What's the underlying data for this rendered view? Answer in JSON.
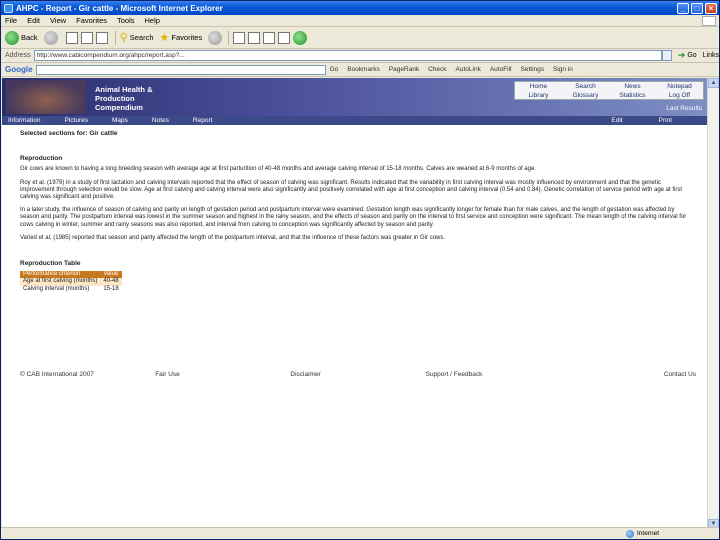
{
  "window": {
    "title": "AHPC - Report - Gir cattle - Microsoft Internet Explorer",
    "minimize": "_",
    "maximize": "□",
    "close": "×"
  },
  "menu": [
    "File",
    "Edit",
    "View",
    "Favorites",
    "Tools",
    "Help"
  ],
  "toolbar": {
    "back": "Back",
    "search": "Search",
    "favorites": "Favorites"
  },
  "address": {
    "label": "Address",
    "url": "http://www.cabicompendium.org/ahpc/report.asp?...",
    "go": "Go",
    "links": "Links"
  },
  "google": {
    "logo": "Google",
    "items": [
      "Go",
      "Bookmarks",
      "PageRank",
      "Check",
      "AutoLink",
      "AutoFill",
      "Settings",
      "Sign in"
    ]
  },
  "site": {
    "brand_lines": [
      "Animal Health &",
      "Production",
      "Compendium"
    ],
    "nav": [
      "Home",
      "Search",
      "News",
      "Notepad",
      "Library",
      "Glossary",
      "Statistics",
      "Log Off"
    ],
    "last_results": "Last Results",
    "tabs": [
      "Information",
      "Pictures",
      "Maps",
      "Notes",
      "Report"
    ],
    "tabs_right": [
      "Edit",
      "Print"
    ]
  },
  "page": {
    "heading": "Selected sections for: Gir cattle",
    "section": "Reproduction",
    "paragraphs": [
      "Gir cows are known to having a long breeding season with average age at first parturition of 40-48 months and average calving interval of 15-18 months. Calves are weaned at 6-9 months of age.",
      "Roy et al. (1979) in a study of first lactation and calving intervals reported that the effect of season of calving was significant. Results indicated that the variability in first calving interval was mostly influenced by environment and that the genetic improvement through selection would be slow. Age at first calving and calving interval were also significantly and positively correlated with age at first conception and calving interval (0.54 and 0.84). Genetic correlation of service period with age at first calving was significant and positive.",
      "In a later study, the influence of season of calving and parity on length of gestation period and postpartum interval were examined. Gestation length was significantly longer for female than for male calves, and the length of gestation was affected by season and parity. The postpartum interval was lowest in the summer season and highest in the rainy season, and the effects of season and parity on the interval to first service and conception were significant. The mean length of the calving interval for cows calving in winter, summer and rainy seasons was also reported, and interval from calving to conception was significantly affected by season and parity.",
      "Varied et al. (1985) reported that season and parity affected the length of the postpartum interval, and that the influence of these factors was greater in Gir cows."
    ],
    "table_title": "Reproduction Table",
    "table_header": [
      "Performance criterion",
      "Value"
    ],
    "table_rows": [
      [
        "Age at first calving (months)",
        "40-48"
      ],
      [
        "Calving interval (months)",
        "15-18"
      ]
    ]
  },
  "footer": [
    "© CAB International 2007",
    "Fair Use",
    "Disclaimer",
    "Support / Feedback",
    "Contact Us"
  ],
  "status": {
    "zone": "Internet"
  }
}
